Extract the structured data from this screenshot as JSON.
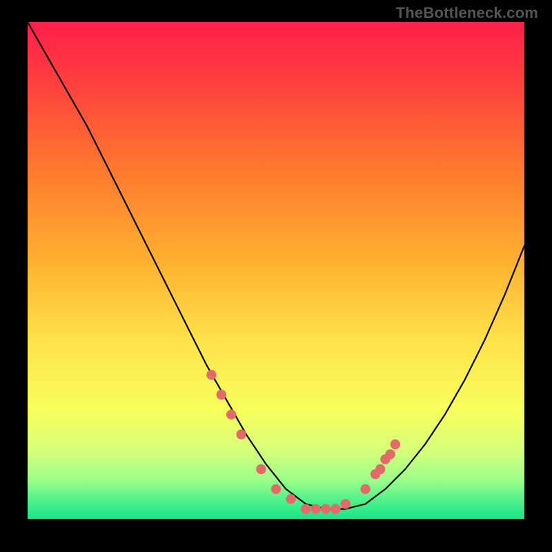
{
  "watermark": "TheBottleneck.com",
  "colors": {
    "bg": "#000000",
    "dot": "#e46a6a",
    "curve": "#000000",
    "watermark": "#555555"
  },
  "chart_data": {
    "type": "line",
    "title": "",
    "xlabel": "",
    "ylabel": "",
    "xlim": [
      0,
      100
    ],
    "ylim": [
      0,
      100
    ],
    "grid": false,
    "legend": false,
    "note": "Values are estimated percentages of plot extent; x left→right, y bottom→top. Single V-shaped curve over a vertical red→yellow→green heat gradient. Dots highlight the segment of the curve around the minimum.",
    "gradient_stops": [
      {
        "pos": 0.0,
        "color": "#ff1f4b"
      },
      {
        "pos": 0.12,
        "color": "#ff3f3e"
      },
      {
        "pos": 0.3,
        "color": "#ff7a2e"
      },
      {
        "pos": 0.48,
        "color": "#ffb030"
      },
      {
        "pos": 0.64,
        "color": "#ffe24a"
      },
      {
        "pos": 0.78,
        "color": "#f7ff5a"
      },
      {
        "pos": 0.86,
        "color": "#d8ff7a"
      },
      {
        "pos": 0.92,
        "color": "#9dff8a"
      },
      {
        "pos": 0.965,
        "color": "#4cf08a"
      },
      {
        "pos": 1.0,
        "color": "#17e58a"
      }
    ],
    "series": [
      {
        "name": "bottleneck-curve",
        "x": [
          0,
          4,
          8,
          12,
          16,
          20,
          24,
          28,
          32,
          36,
          40,
          44,
          48,
          52,
          56,
          60,
          64,
          68,
          72,
          76,
          80,
          84,
          88,
          92,
          96,
          100
        ],
        "y": [
          100,
          93,
          86,
          79,
          71,
          63,
          55,
          47,
          39,
          31,
          24,
          17,
          11,
          6,
          3,
          2,
          2,
          3,
          6,
          10,
          15,
          21,
          28,
          36,
          45,
          55
        ]
      }
    ],
    "highlight_dots": {
      "name": "near-minimum-dots",
      "x": [
        37,
        39,
        41,
        43,
        47,
        50,
        53,
        56,
        58,
        60,
        62,
        64,
        68,
        70,
        71,
        72,
        73,
        74
      ],
      "y": [
        29,
        25,
        21,
        17,
        10,
        6,
        4,
        2,
        2,
        2,
        2,
        3,
        6,
        9,
        10,
        12,
        13,
        15
      ]
    }
  }
}
